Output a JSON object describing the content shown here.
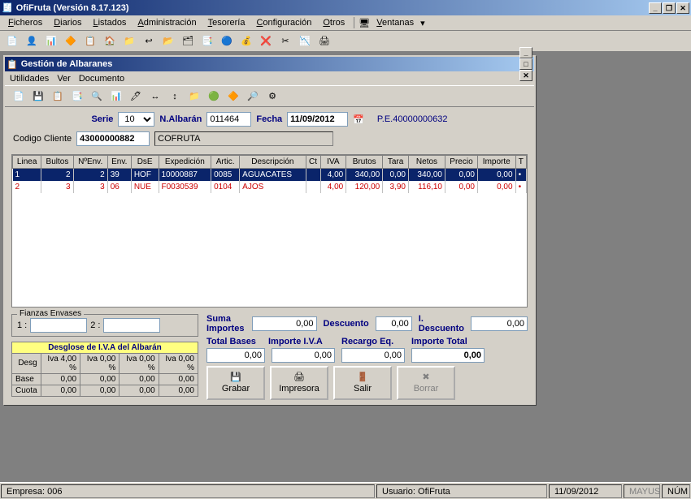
{
  "app": {
    "title": "OfiFruta  (Versión 8.17.123)"
  },
  "mainmenu": {
    "ficheros": "Ficheros",
    "diarios": "Diarios",
    "listados": "Listados",
    "administracion": "Administración",
    "tesoreria": "Tesorería",
    "configuracion": "Configuración",
    "otros": "Otros",
    "ventanas": "Ventanas"
  },
  "child": {
    "title": "Gestión de Albaranes",
    "menu": {
      "utilidades": "Utilidades",
      "ver": "Ver",
      "documento": "Documento"
    }
  },
  "form": {
    "serie_label": "Serie",
    "serie_value": "10",
    "nalbaran_label": "N.Albarán",
    "nalbaran_value": "011464",
    "fecha_label": "Fecha",
    "fecha_value": "11/09/2012",
    "pe_label": "P.E.40000000632",
    "codcli_label": "Codigo Cliente",
    "codcli_value": "43000000882",
    "codcli_name": "COFRUTA"
  },
  "grid": {
    "headers": [
      "Linea",
      "Bultos",
      "NºEnv.",
      "Env.",
      "DsE",
      "Expedición",
      "Artic.",
      "Descripción",
      "Ct",
      "IVA",
      "Brutos",
      "Tara",
      "Netos",
      "Precio",
      "Importe",
      "T"
    ],
    "rows": [
      {
        "sel": true,
        "linea": "1",
        "bultos": "2",
        "nenv": "2",
        "env": "39",
        "dse": "HOF",
        "exped": "10000887",
        "artic": "0085",
        "desc": "AGUACATES",
        "ct": "",
        "iva": "4,00",
        "brutos": "340,00",
        "tara": "0,00",
        "netos": "340,00",
        "precio": "0,00",
        "importe": "0,00",
        "t": "•"
      },
      {
        "red": true,
        "linea": "2",
        "bultos": "3",
        "nenv": "3",
        "env": "06",
        "dse": "NUE",
        "exped": "F0030539",
        "artic": "0104",
        "desc": "AJOS",
        "ct": "",
        "iva": "4,00",
        "brutos": "120,00",
        "tara": "3,90",
        "netos": "116,10",
        "precio": "0,00",
        "importe": "0,00",
        "t": "•"
      }
    ]
  },
  "fianzas": {
    "legend": "Fianzas Envases",
    "l1": "1 :",
    "v1": "",
    "l2": "2 :",
    "v2": ""
  },
  "sums": {
    "suma_label": "Suma Importes",
    "suma_value": "0,00",
    "desc_label": "Descuento",
    "desc_value": "0,00",
    "idesc_label": "I. Descuento",
    "idesc_value": "0,00",
    "tbases_label": "Total Bases",
    "tbases_value": "0,00",
    "iiva_label": "Importe I.V.A",
    "iiva_value": "0,00",
    "req_label": "Recargo Eq.",
    "req_value": "0,00",
    "itotal_label": "Importe Total",
    "itotal_value": "0,00"
  },
  "desglose": {
    "title": "Desglose de I.V.A del Albarán",
    "cols": [
      "Desg",
      "Iva 4,00 %",
      "Iva 0,00 %",
      "Iva 0,00 %",
      "Iva 0,00 %"
    ],
    "rows": [
      {
        "label": "Base",
        "v": [
          "0,00",
          "0,00",
          "0,00",
          "0,00"
        ]
      },
      {
        "label": "Cuota",
        "v": [
          "0,00",
          "0,00",
          "0,00",
          "0,00"
        ]
      }
    ]
  },
  "buttons": {
    "grabar": "Grabar",
    "impresora": "Impresora",
    "salir": "Salir",
    "borrar": "Borrar"
  },
  "status": {
    "empresa": "Empresa: 006",
    "usuario": "Usuario: OfiFruta",
    "fecha": "11/09/2012",
    "mayus": "MAYUS",
    "num": "NÚM"
  }
}
